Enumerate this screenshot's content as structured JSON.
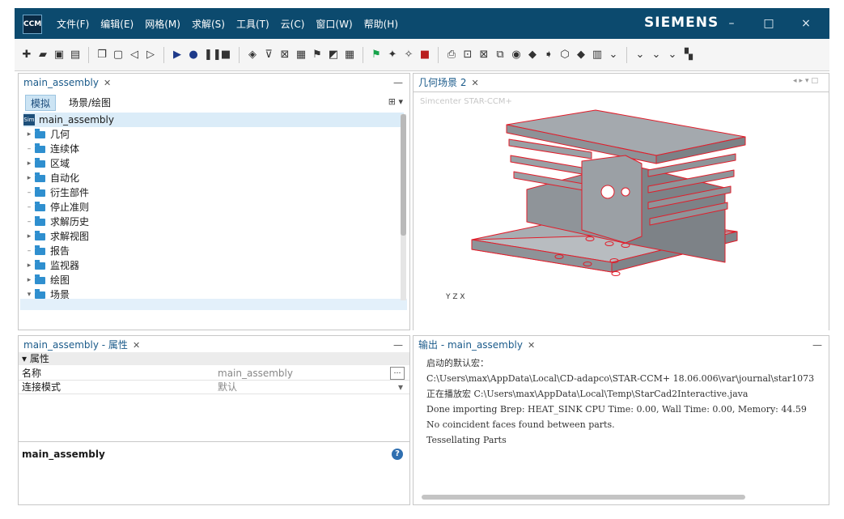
{
  "app": {
    "logo_text": "CCM",
    "brand": "SIEMENS",
    "menu": [
      "文件(F)",
      "编辑(E)",
      "网格(M)",
      "求解(S)",
      "工具(T)",
      "云(C)",
      "窗口(W)",
      "帮助(H)"
    ],
    "window_controls": [
      "–",
      "□",
      "×"
    ]
  },
  "tree_panel": {
    "tab": "main_assembly",
    "subtabs": [
      "模拟",
      "场景/绘图"
    ],
    "root": "main_assembly",
    "items": [
      {
        "label": "几何",
        "expandable": true
      },
      {
        "label": "连续体",
        "expandable": false
      },
      {
        "label": "区域",
        "expandable": true
      },
      {
        "label": "自动化",
        "expandable": true
      },
      {
        "label": "衍生部件",
        "expandable": false
      },
      {
        "label": "停止准则",
        "expandable": false
      },
      {
        "label": "求解历史",
        "expandable": false
      },
      {
        "label": "求解视图",
        "expandable": true
      },
      {
        "label": "报告",
        "expandable": false
      },
      {
        "label": "监视器",
        "expandable": true
      },
      {
        "label": "绘图",
        "expandable": true
      },
      {
        "label": "场景",
        "expandable": true
      }
    ]
  },
  "scene_panel": {
    "tab": "几何场景 2",
    "watermark": "Simcenter STAR-CCM+",
    "axes_label": "Y Z X"
  },
  "props_panel": {
    "tab": "main_assembly - 属性",
    "group": "属性",
    "rows": [
      {
        "key": "名称",
        "value": "main_assembly"
      },
      {
        "key": "连接模式",
        "value": "默认"
      }
    ],
    "description": "main_assembly"
  },
  "output_panel": {
    "tab": "输出 - main_assembly",
    "lines": [
      "启动的默认宏：",
      "C:\\Users\\max\\AppData\\Local\\CD-adapco\\STAR-CCM+ 18.06.006\\var\\journal\\star1073",
      "正在播放宏 C:\\Users\\max\\AppData\\Local\\Temp\\StarCad2Interactive.java",
      "Done importing Brep: HEAT_SINK CPU Time: 0.00, Wall Time: 0.00, Memory: 44.59",
      "No coincident faces found between parts.",
      "Tessellating Parts"
    ]
  },
  "colors": {
    "titlebar": "#0c4a6e",
    "edge_red": "#e11d2a",
    "model_gray": "#9ea3a8"
  }
}
